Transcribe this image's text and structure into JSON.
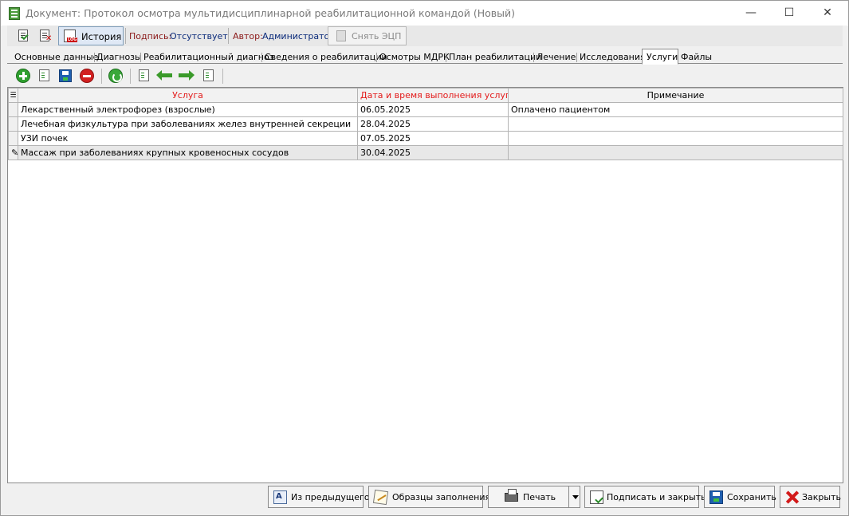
{
  "window": {
    "title": "Документ: Протокол осмотра мультидисциплинарной реабилитационной командой (Новый)",
    "controls": {
      "minimize": "—",
      "maximize": "☐",
      "close": "✕"
    }
  },
  "toolbar": {
    "history_label": "История",
    "signature_label": "Подпись:",
    "signature_value": "Отсутствует",
    "author_label": "Автор:",
    "author_value": "Администратор",
    "remove_signature_label": "Снять ЭЦП"
  },
  "tabs": [
    {
      "label": "Основные данные"
    },
    {
      "label": "Диагнозы"
    },
    {
      "label": "Реабилитационный диагноз"
    },
    {
      "label": "Сведения о реабилитации"
    },
    {
      "label": "Осмотры МДРК"
    },
    {
      "label": "План реабилитации"
    },
    {
      "label": "Лечение"
    },
    {
      "label": "Исследования"
    },
    {
      "label": "Услуги",
      "active": true
    },
    {
      "label": "Файлы"
    }
  ],
  "grid": {
    "columns": [
      {
        "label": "Услуга",
        "required": true
      },
      {
        "label": "Дата и время выполнения услуги",
        "required": true
      },
      {
        "label": "Примечание",
        "required": false
      }
    ],
    "rows": [
      {
        "service": "Лекарственный электрофорез (взрослые)",
        "date": "06.05.2025",
        "note": "Оплачено пациентом"
      },
      {
        "service": "Лечебная физкультура при заболеваниях желез внутренней секреции",
        "date": "28.04.2025",
        "note": ""
      },
      {
        "service": "УЗИ почек",
        "date": "07.05.2025",
        "note": ""
      },
      {
        "service": "Массаж при заболеваниях крупных кровеносных сосудов",
        "date": "30.04.2025",
        "note": ""
      }
    ],
    "edit_row_indicator": "✎"
  },
  "bottom": {
    "from_previous": "Из предыдущего",
    "samples": "Образцы заполнения",
    "print": "Печать",
    "sign_and_close": "Подписать и закрыть",
    "save": "Сохранить",
    "close": "Закрыть"
  },
  "colors": {
    "required_header": "#e31b1b",
    "label_red": "#8b1a1a",
    "value_blue": "#0a2a7a"
  }
}
